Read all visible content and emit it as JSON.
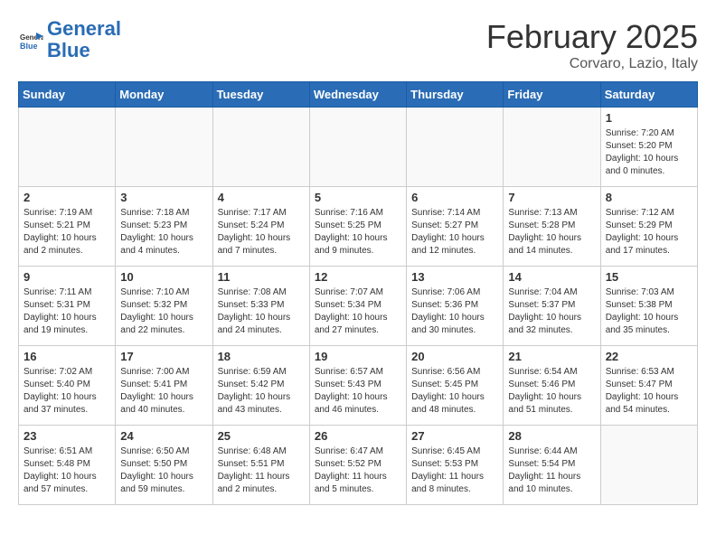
{
  "header": {
    "logo_line1": "General",
    "logo_line2": "Blue",
    "title": "February 2025",
    "subtitle": "Corvaro, Lazio, Italy"
  },
  "weekdays": [
    "Sunday",
    "Monday",
    "Tuesday",
    "Wednesday",
    "Thursday",
    "Friday",
    "Saturday"
  ],
  "weeks": [
    [
      {
        "day": "",
        "info": ""
      },
      {
        "day": "",
        "info": ""
      },
      {
        "day": "",
        "info": ""
      },
      {
        "day": "",
        "info": ""
      },
      {
        "day": "",
        "info": ""
      },
      {
        "day": "",
        "info": ""
      },
      {
        "day": "1",
        "info": "Sunrise: 7:20 AM\nSunset: 5:20 PM\nDaylight: 10 hours\nand 0 minutes."
      }
    ],
    [
      {
        "day": "2",
        "info": "Sunrise: 7:19 AM\nSunset: 5:21 PM\nDaylight: 10 hours\nand 2 minutes."
      },
      {
        "day": "3",
        "info": "Sunrise: 7:18 AM\nSunset: 5:23 PM\nDaylight: 10 hours\nand 4 minutes."
      },
      {
        "day": "4",
        "info": "Sunrise: 7:17 AM\nSunset: 5:24 PM\nDaylight: 10 hours\nand 7 minutes."
      },
      {
        "day": "5",
        "info": "Sunrise: 7:16 AM\nSunset: 5:25 PM\nDaylight: 10 hours\nand 9 minutes."
      },
      {
        "day": "6",
        "info": "Sunrise: 7:14 AM\nSunset: 5:27 PM\nDaylight: 10 hours\nand 12 minutes."
      },
      {
        "day": "7",
        "info": "Sunrise: 7:13 AM\nSunset: 5:28 PM\nDaylight: 10 hours\nand 14 minutes."
      },
      {
        "day": "8",
        "info": "Sunrise: 7:12 AM\nSunset: 5:29 PM\nDaylight: 10 hours\nand 17 minutes."
      }
    ],
    [
      {
        "day": "9",
        "info": "Sunrise: 7:11 AM\nSunset: 5:31 PM\nDaylight: 10 hours\nand 19 minutes."
      },
      {
        "day": "10",
        "info": "Sunrise: 7:10 AM\nSunset: 5:32 PM\nDaylight: 10 hours\nand 22 minutes."
      },
      {
        "day": "11",
        "info": "Sunrise: 7:08 AM\nSunset: 5:33 PM\nDaylight: 10 hours\nand 24 minutes."
      },
      {
        "day": "12",
        "info": "Sunrise: 7:07 AM\nSunset: 5:34 PM\nDaylight: 10 hours\nand 27 minutes."
      },
      {
        "day": "13",
        "info": "Sunrise: 7:06 AM\nSunset: 5:36 PM\nDaylight: 10 hours\nand 30 minutes."
      },
      {
        "day": "14",
        "info": "Sunrise: 7:04 AM\nSunset: 5:37 PM\nDaylight: 10 hours\nand 32 minutes."
      },
      {
        "day": "15",
        "info": "Sunrise: 7:03 AM\nSunset: 5:38 PM\nDaylight: 10 hours\nand 35 minutes."
      }
    ],
    [
      {
        "day": "16",
        "info": "Sunrise: 7:02 AM\nSunset: 5:40 PM\nDaylight: 10 hours\nand 37 minutes."
      },
      {
        "day": "17",
        "info": "Sunrise: 7:00 AM\nSunset: 5:41 PM\nDaylight: 10 hours\nand 40 minutes."
      },
      {
        "day": "18",
        "info": "Sunrise: 6:59 AM\nSunset: 5:42 PM\nDaylight: 10 hours\nand 43 minutes."
      },
      {
        "day": "19",
        "info": "Sunrise: 6:57 AM\nSunset: 5:43 PM\nDaylight: 10 hours\nand 46 minutes."
      },
      {
        "day": "20",
        "info": "Sunrise: 6:56 AM\nSunset: 5:45 PM\nDaylight: 10 hours\nand 48 minutes."
      },
      {
        "day": "21",
        "info": "Sunrise: 6:54 AM\nSunset: 5:46 PM\nDaylight: 10 hours\nand 51 minutes."
      },
      {
        "day": "22",
        "info": "Sunrise: 6:53 AM\nSunset: 5:47 PM\nDaylight: 10 hours\nand 54 minutes."
      }
    ],
    [
      {
        "day": "23",
        "info": "Sunrise: 6:51 AM\nSunset: 5:48 PM\nDaylight: 10 hours\nand 57 minutes."
      },
      {
        "day": "24",
        "info": "Sunrise: 6:50 AM\nSunset: 5:50 PM\nDaylight: 10 hours\nand 59 minutes."
      },
      {
        "day": "25",
        "info": "Sunrise: 6:48 AM\nSunset: 5:51 PM\nDaylight: 11 hours\nand 2 minutes."
      },
      {
        "day": "26",
        "info": "Sunrise: 6:47 AM\nSunset: 5:52 PM\nDaylight: 11 hours\nand 5 minutes."
      },
      {
        "day": "27",
        "info": "Sunrise: 6:45 AM\nSunset: 5:53 PM\nDaylight: 11 hours\nand 8 minutes."
      },
      {
        "day": "28",
        "info": "Sunrise: 6:44 AM\nSunset: 5:54 PM\nDaylight: 11 hours\nand 10 minutes."
      },
      {
        "day": "",
        "info": ""
      }
    ]
  ]
}
